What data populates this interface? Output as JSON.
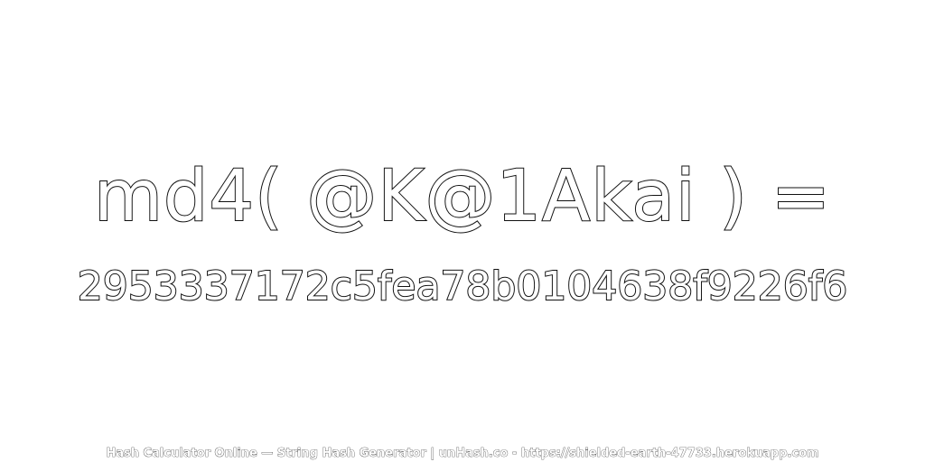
{
  "heading": {
    "expression": "md4( @K@1Akai ) ="
  },
  "result": {
    "hash": "2953337172c5fea78b0104638f9226f6"
  },
  "footer": {
    "text": "Hash Calculator Online — String Hash Generator | unHash.co - https://shielded-earth-47733.herokuapp.com"
  }
}
